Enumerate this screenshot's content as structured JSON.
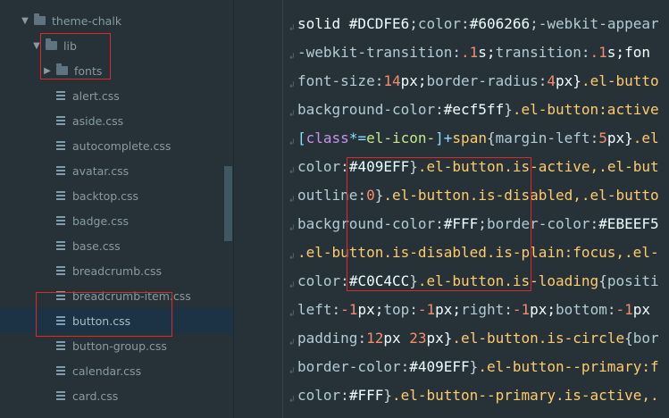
{
  "sidebar": {
    "items": [
      {
        "label": "theme-chalk",
        "type": "folder",
        "expanded": true
      },
      {
        "label": "lib",
        "type": "folder",
        "expanded": true
      },
      {
        "label": "fonts",
        "type": "folder",
        "expanded": false
      },
      {
        "label": "alert.css",
        "type": "file"
      },
      {
        "label": "aside.css",
        "type": "file"
      },
      {
        "label": "autocomplete.css",
        "type": "file"
      },
      {
        "label": "avatar.css",
        "type": "file"
      },
      {
        "label": "backtop.css",
        "type": "file"
      },
      {
        "label": "badge.css",
        "type": "file"
      },
      {
        "label": "base.css",
        "type": "file"
      },
      {
        "label": "breadcrumb.css",
        "type": "file"
      },
      {
        "label": "breadcrumb-item.css",
        "type": "file"
      },
      {
        "label": "button.css",
        "type": "file",
        "selected": true
      },
      {
        "label": "button-group.css",
        "type": "file"
      },
      {
        "label": "calendar.css",
        "type": "file"
      },
      {
        "label": "card.css",
        "type": "file"
      }
    ]
  },
  "editor": {
    "lines": [
      [
        "solid ",
        "#DCDFE6",
        ";",
        "color",
        ":",
        "#606266",
        ";-webkit-appear"
      ],
      [
        "-webkit-transition",
        ":",
        ".1",
        "s;",
        "transition",
        ":",
        ".1",
        "s;fon"
      ],
      [
        "font-size",
        ":",
        "14",
        "px;",
        "border-radius",
        ":",
        "4",
        "px}",
        ".el-butto"
      ],
      [
        "background-color",
        ":",
        "#ecf5ff",
        "}",
        ".el-button:active"
      ],
      [
        "[",
        "class",
        "*=",
        "el-icon-",
        "]",
        "+",
        "span",
        "{",
        "margin-left",
        ":",
        "5",
        "px}",
        ".el"
      ],
      [
        "color",
        ":",
        "#409EFF",
        "}",
        ".el-button.is-active,.el-but"
      ],
      [
        "outline",
        ":",
        "0",
        "}",
        ".el-button.is-disabled,.el-butto"
      ],
      [
        "background-color",
        ":",
        "#FFF",
        ";",
        "border-color",
        ":",
        "#EBEEF5"
      ],
      [
        ".el-button.is-disabled.is-plain:focus,.el-"
      ],
      [
        "color",
        ":",
        "#C0C4CC",
        "}",
        ".el-button.is-loading",
        "{",
        "positi"
      ],
      [
        "left",
        ":",
        "-1",
        "px;",
        "top",
        ":",
        "-1",
        "px;",
        "right",
        ":",
        "-1",
        "px;",
        "bottom",
        ":",
        "-1",
        "px"
      ],
      [
        "padding",
        ":",
        "12",
        "px ",
        "23",
        "px}",
        ".el-button.is-circle",
        "{",
        "bor"
      ],
      [
        "border-color",
        ":",
        "#409EFF",
        "}",
        ".el-button--primary:f"
      ],
      [
        "color",
        ":",
        "#FFF",
        "}",
        ".el-button--primary.is-active,."
      ]
    ]
  },
  "colors": {
    "annotation": "#e0282a",
    "selection": "#1b3344",
    "background": "#263238"
  }
}
